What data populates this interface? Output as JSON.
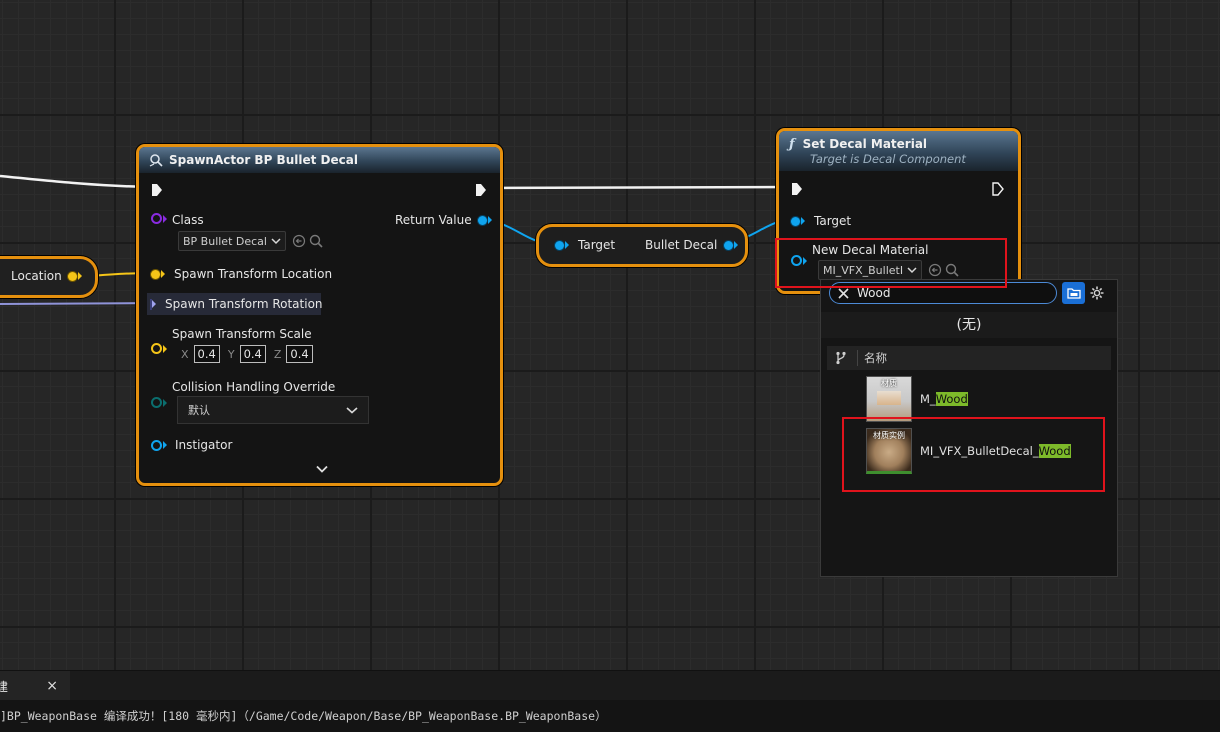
{
  "spawn_node": {
    "title": "SpawnActor BP Bullet Decal",
    "class_label": "Class",
    "class_value": "BP Bullet Decal",
    "return_value_label": "Return Value",
    "spawn_location_label": "Spawn Transform Location",
    "spawn_rotation_label": "Spawn Transform Rotation",
    "spawn_scale_label": "Spawn Transform Scale",
    "scale_x_label": "X",
    "scale_x": "0.4",
    "scale_y_label": "Y",
    "scale_y": "0.4",
    "scale_z_label": "Z",
    "scale_z": "0.4",
    "collision_label": "Collision Handling Override",
    "collision_value": "默认",
    "instigator_label": "Instigator"
  },
  "location_node": {
    "label": "Location"
  },
  "target_node": {
    "target_label": "Target",
    "output_label": "Bullet Decal"
  },
  "set_decal_node": {
    "title": "Set Decal Material",
    "subtitle": "Target is Decal Component",
    "target_label": "Target",
    "material_label": "New Decal Material",
    "material_value": "MI_VFX_BulletI"
  },
  "picker": {
    "search_value": "Wood",
    "none_option": "(无)",
    "column_header": "名称",
    "items": [
      {
        "thumb_label": "材质",
        "name_prefix": "M_",
        "name_match": "Wood"
      },
      {
        "thumb_label": "材质实例",
        "name_prefix": "MI_VFX_BulletDecal_",
        "name_match": "Wood"
      }
    ]
  },
  "bottom_tab": {
    "label": "建",
    "close": "×"
  },
  "log": {
    "message": "]BP_WeaponBase 编译成功！[180 毫秒内]（/Game/Code/Weapon/Base/BP_WeaponBase.BP_WeaponBase）"
  },
  "colors": {
    "node_border": "#e5900e",
    "object_pin": "#0fa4ef",
    "vector_pin": "#f5c518",
    "rotator_pin": "#a0a4f0",
    "class_pin": "#8a2be2",
    "enum_pin": "#0b6e6e",
    "highlight": "#7dba2a",
    "annotation": "#e0131c"
  }
}
